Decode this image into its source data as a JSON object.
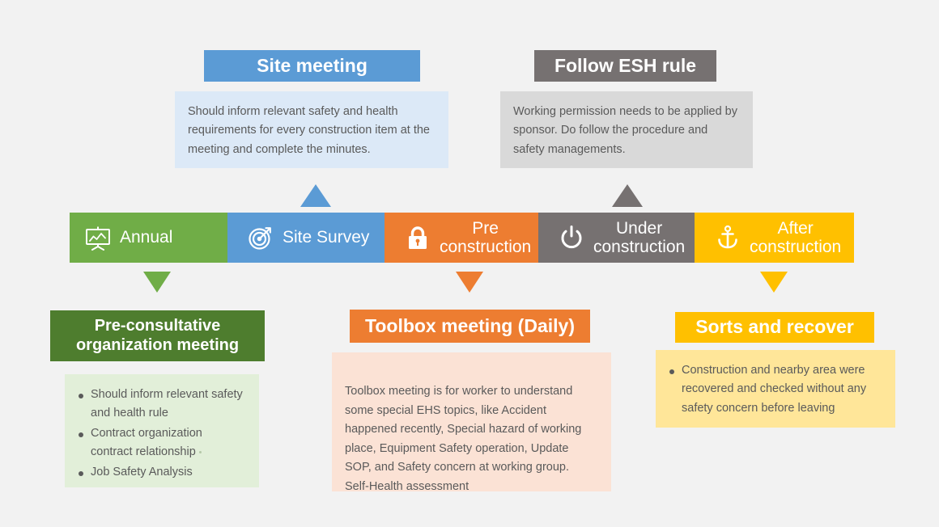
{
  "page": {
    "background": "#f2f2f2",
    "body_text_color": "#5a5a5a"
  },
  "process_bar": {
    "name": "construction-safety-process-bar",
    "steps": [
      {
        "label": "Annual",
        "icon": "presentation-board-icon",
        "color": "#70ad47",
        "lines": 1
      },
      {
        "label": "Site Survey",
        "icon": "target-icon",
        "color": "#5b9bd5",
        "lines": 1
      },
      {
        "label": "Pre\nconstruction",
        "icon": "lock-icon",
        "color": "#ed7d31",
        "lines": 2
      },
      {
        "label": "Under\nconstruction",
        "icon": "power-icon",
        "color": "#767171",
        "lines": 2
      },
      {
        "label": "After\nconstruction",
        "icon": "anchor-icon",
        "color": "#ffc000",
        "lines": 2
      }
    ]
  },
  "callouts": {
    "site_meeting": {
      "title": "Site meeting",
      "header_color": "#5b9bd5",
      "body_color": "#dce9f7",
      "text": "Should inform relevant safety and health requirements for every construction item at the meeting and complete the minutes.",
      "connector": {
        "direction": "up",
        "color": "#5b9bd5"
      }
    },
    "follow_esh_rule": {
      "title": "Follow ESH rule",
      "header_color": "#767171",
      "body_color": "#d9d9d9",
      "text": "Working permission needs to be applied by sponsor. Do follow the procedure and safety managements.",
      "connector": {
        "direction": "up",
        "color": "#767171"
      }
    },
    "pre_consultative": {
      "title": "Pre-consultative organization meeting",
      "header_color": "#4e7d2e",
      "body_color": "#e2efd9",
      "bullets": [
        "Should inform relevant safety and health rule",
        "Contract organization contract relationship",
        "Job Safety Analysis"
      ],
      "connector": {
        "direction": "down",
        "color": "#70ad47"
      }
    },
    "toolbox_meeting": {
      "title": "Toolbox meeting (Daily)",
      "header_color": "#ed7d31",
      "body_color": "#fbe2d5",
      "text": "Toolbox meeting is for worker to understand some special EHS topics, like Accident happened recently, Special hazard of working place, Equipment Safety operation, Update SOP, and Safety concern at working group.\nSelf-Health assessment",
      "connector": {
        "direction": "down",
        "color": "#ed7d31"
      }
    },
    "sorts_and_recover": {
      "title": "Sorts and recover",
      "header_color": "#ffc000",
      "body_color": "#ffe699",
      "bullets": [
        "Construction and nearby area were recovered and checked without any safety concern before leaving"
      ],
      "connector": {
        "direction": "down",
        "color": "#ffc000"
      }
    }
  }
}
